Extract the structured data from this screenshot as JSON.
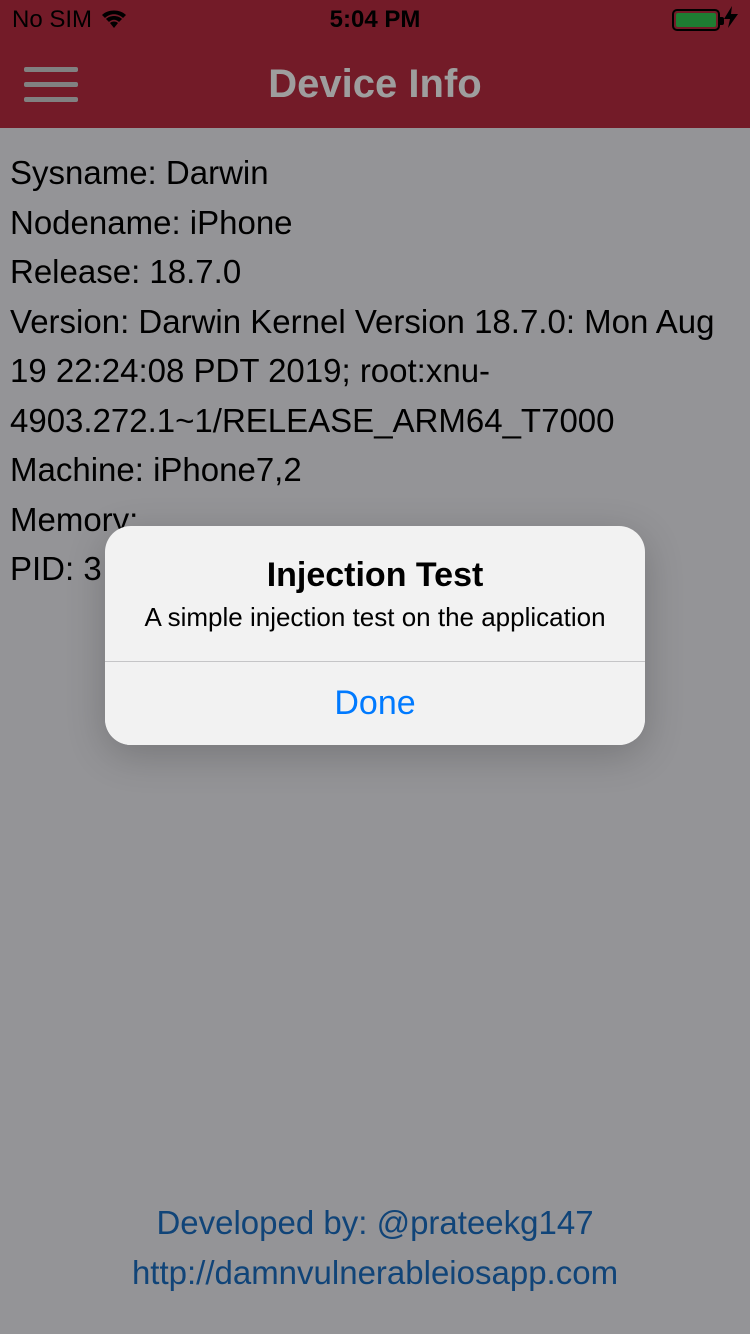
{
  "status_bar": {
    "carrier": "No SIM",
    "time": "5:04 PM"
  },
  "nav": {
    "title": "Device Info"
  },
  "device": {
    "sysname_label": "Sysname: ",
    "sysname": "Darwin",
    "nodename_label": "Nodename: ",
    "nodename": "iPhone",
    "release_label": "Release: ",
    "release": "18.7.0",
    "version_label": "Version: ",
    "version": "Darwin Kernel Version 18.7.0: Mon Aug 19 22:24:08 PDT 2019; root:xnu-4903.272.1~1/RELEASE_ARM64_T7000",
    "machine_label": "Machine: ",
    "machine": "iPhone7,2",
    "memory_label": "Memory: ",
    "pid_label": "PID: ",
    "pid_partial": "3"
  },
  "footer": {
    "developed_by": "Developed by: @prateekg147",
    "url": "http://damnvulnerableiosapp.com"
  },
  "alert": {
    "title": "Injection Test",
    "message": "A simple injection test on the application",
    "button": "Done"
  }
}
